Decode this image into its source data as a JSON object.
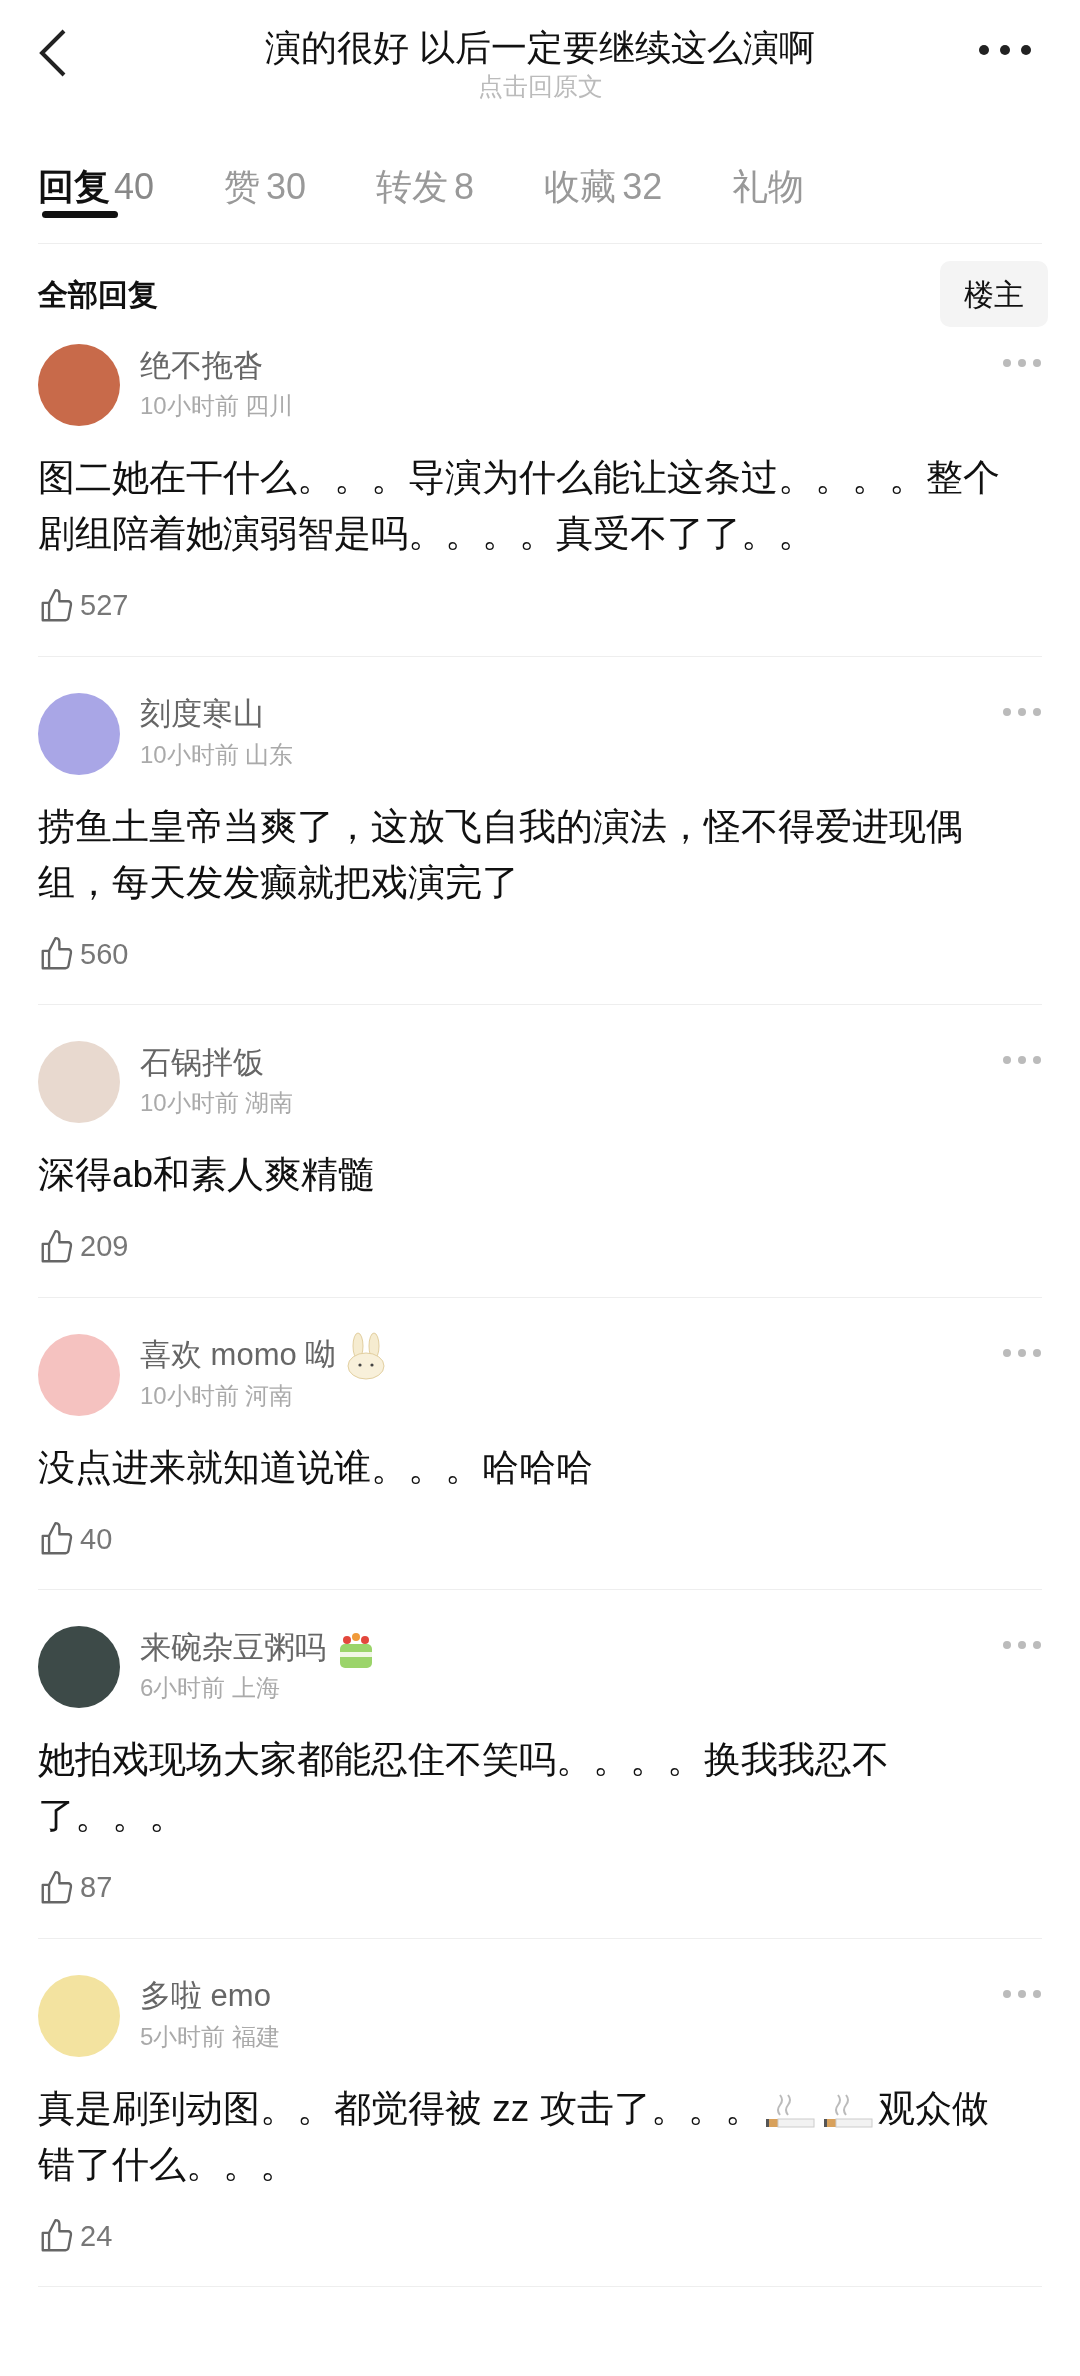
{
  "header": {
    "title": "演的很好 以后一定要继续这么演啊",
    "subtitle": "点击回原文"
  },
  "tabs": [
    {
      "label": "回复",
      "count": "40",
      "selected": true
    },
    {
      "label": "赞",
      "count": "30",
      "selected": false
    },
    {
      "label": "转发",
      "count": "8",
      "selected": false
    },
    {
      "label": "收藏",
      "count": "32",
      "selected": false
    },
    {
      "label": "礼物",
      "selected": false
    }
  ],
  "section": {
    "title": "全部回复",
    "filter": "楼主"
  },
  "comments": [
    {
      "name": "绝不拖沓",
      "time": "10小时前 四川",
      "segments": [
        {
          "kind": "text",
          "text": "图二她在干什么。。。导演为什么能让这条过。。。。整个剧组陪着她演弱智是吗。。。。真受不了了。。"
        }
      ],
      "likes": "527"
    },
    {
      "name": "刻度寒山",
      "time": "10小时前 山东",
      "segments": [
        {
          "kind": "text",
          "text": "捞鱼土皇帝当爽了，这放飞自我的演法，怪不得爱进现偶组，每天发发癫就把戏演完了"
        }
      ],
      "likes": "560"
    },
    {
      "name": "石锅拌饭",
      "time": "10小时前 湖南",
      "segments": [
        {
          "kind": "text",
          "text": "深得ab和素人爽精髓"
        }
      ],
      "likes": "209"
    },
    {
      "name": "喜欢 momo 呦",
      "badge": {
        "kind": "rabbit"
      },
      "time": "10小时前 河南",
      "segments": [
        {
          "kind": "text",
          "text": "没点进来就知道说谁。。。哈哈哈"
        }
      ],
      "likes": "40"
    },
    {
      "name": "来碗杂豆粥吗",
      "badge": {
        "kind": "cake"
      },
      "time": "6小时前 上海",
      "segments": [
        {
          "kind": "text",
          "text": "她拍戏现场大家都能忍住不笑吗。。。。换我我忍不了。。。"
        }
      ],
      "likes": "87"
    },
    {
      "name": "多啦 emo",
      "time": "5小时前 福建",
      "segments": [
        {
          "kind": "text",
          "text": "真是刷到动图。。都觉得被 zz 攻击了。。。"
        },
        {
          "kind": "cigarette"
        },
        {
          "kind": "cigarette"
        },
        {
          "kind": "text",
          "text": "观众做错了什么。。。"
        }
      ],
      "likes": "24"
    }
  ]
}
